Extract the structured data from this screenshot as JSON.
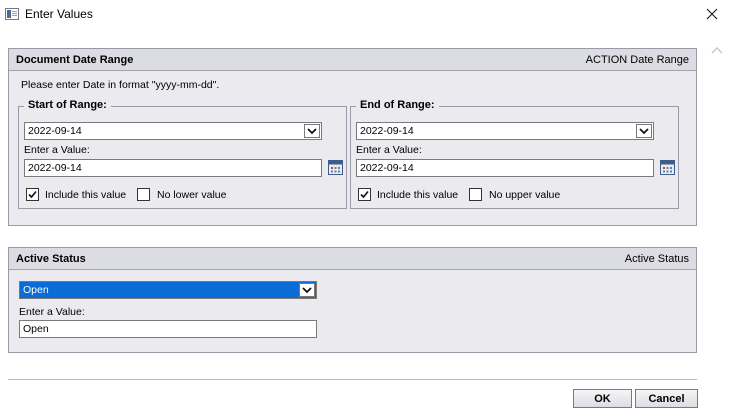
{
  "window": {
    "title": "Enter Values",
    "icons": {
      "app": "app-icon",
      "close": "close-icon",
      "scroll_up": "chevron-up-icon"
    }
  },
  "date_range": {
    "title": "Document Date Range",
    "right_label": "ACTION Date Range",
    "hint": "Please enter Date in format \"yyyy-mm-dd\".",
    "start": {
      "legend": "Start of Range:",
      "select_value": "2022-09-14",
      "value_label": "Enter a Value:",
      "value": "2022-09-14",
      "include_label": "Include this value",
      "include_checked": true,
      "no_bound_label": "No lower value",
      "no_bound_checked": false
    },
    "end": {
      "legend": "End of Range:",
      "select_value": "2022-09-14",
      "value_label": "Enter a Value:",
      "value": "2022-09-14",
      "include_label": "Include this value",
      "include_checked": true,
      "no_bound_label": "No upper value",
      "no_bound_checked": false
    }
  },
  "active_status": {
    "title": "Active Status",
    "right_label": "Active Status",
    "select_value": "Open",
    "value_label": "Enter a Value:",
    "value": "Open"
  },
  "buttons": {
    "ok": "OK",
    "cancel": "Cancel"
  },
  "colors": {
    "panel_bg": "#eaeaef",
    "panel_header": "#dcdce3",
    "selection": "#0a6cd4"
  }
}
